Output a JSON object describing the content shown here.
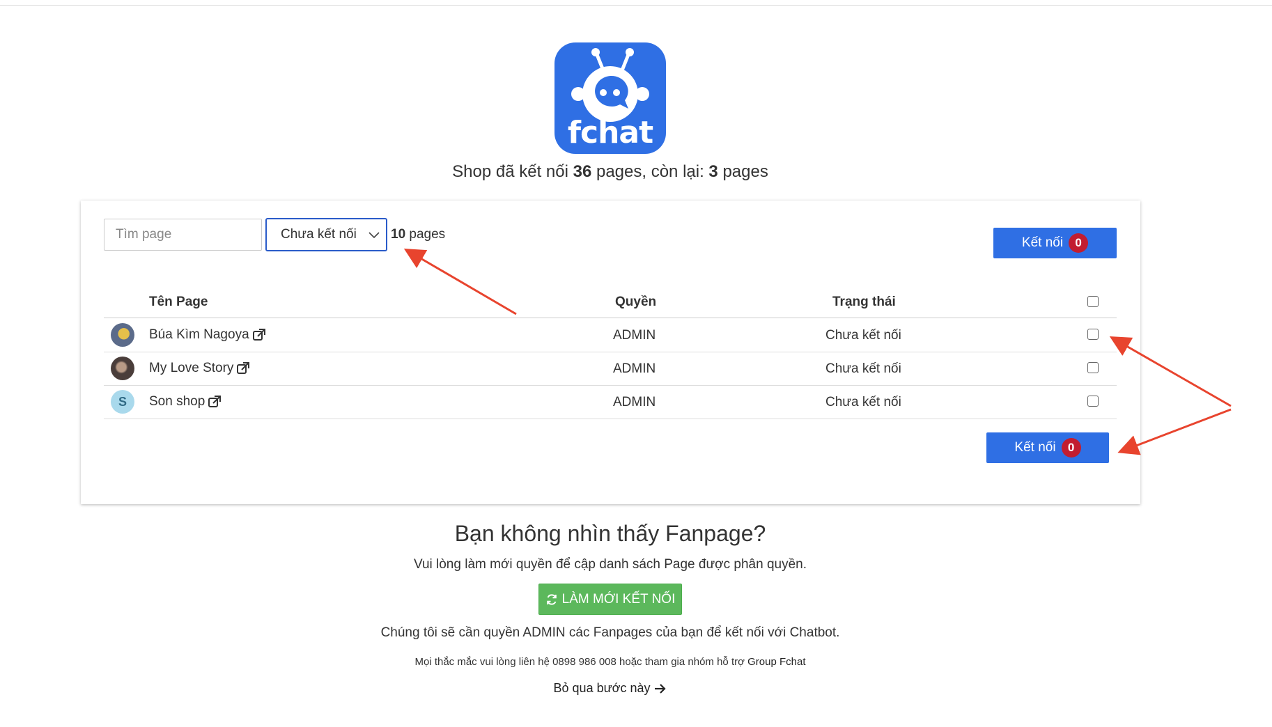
{
  "logo": {
    "text": "fchat"
  },
  "summary": {
    "prefix": "Shop đã kết nối ",
    "connected": "36",
    "middle": " pages, còn lại: ",
    "remaining": "3",
    "suffix": " pages"
  },
  "toolbar": {
    "search_placeholder": "Tìm page",
    "filter_value": "Chưa kết nối",
    "page_count": "10",
    "page_count_label": " pages",
    "connect_label": "Kết nối",
    "connect_count": "0"
  },
  "table": {
    "headers": {
      "name": "Tên Page",
      "role": "Quyền",
      "status": "Trạng thái"
    },
    "rows": [
      {
        "name": "Búa Kìm Nagoya",
        "role": "ADMIN",
        "status": "Chưa kết nối",
        "avatar": ""
      },
      {
        "name": "My Love Story",
        "role": "ADMIN",
        "status": "Chưa kết nối",
        "avatar": ""
      },
      {
        "name": "Son shop",
        "role": "ADMIN",
        "status": "Chưa kết nối",
        "avatar": "S"
      }
    ]
  },
  "footer": {
    "title": "Bạn không nhìn thấy Fanpage?",
    "subtitle": "Vui lòng làm mới quyền để cập danh sách Page được phân quyền.",
    "refresh_label": "LÀM MỚI KẾT NỐI",
    "note": "Chúng tôi sẽ cần quyền ADMIN các Fanpages của bạn để kết nối với Chatbot.",
    "contact_text": "Mọi thắc mắc vui lòng liên hệ 0898 986 008 hoặc tham gia nhóm hỗ trợ ",
    "contact_link": "Group Fchat",
    "skip_label": "Bỏ qua bước này"
  },
  "colors": {
    "primary": "#2f6fe4",
    "badge": "#c21d30",
    "success": "#5cb85c",
    "annotation_arrow": "#e8442e"
  },
  "icons": [
    "robot-logo-icon",
    "chevron-down-icon",
    "external-link-icon",
    "refresh-icon",
    "arrow-right-icon"
  ]
}
